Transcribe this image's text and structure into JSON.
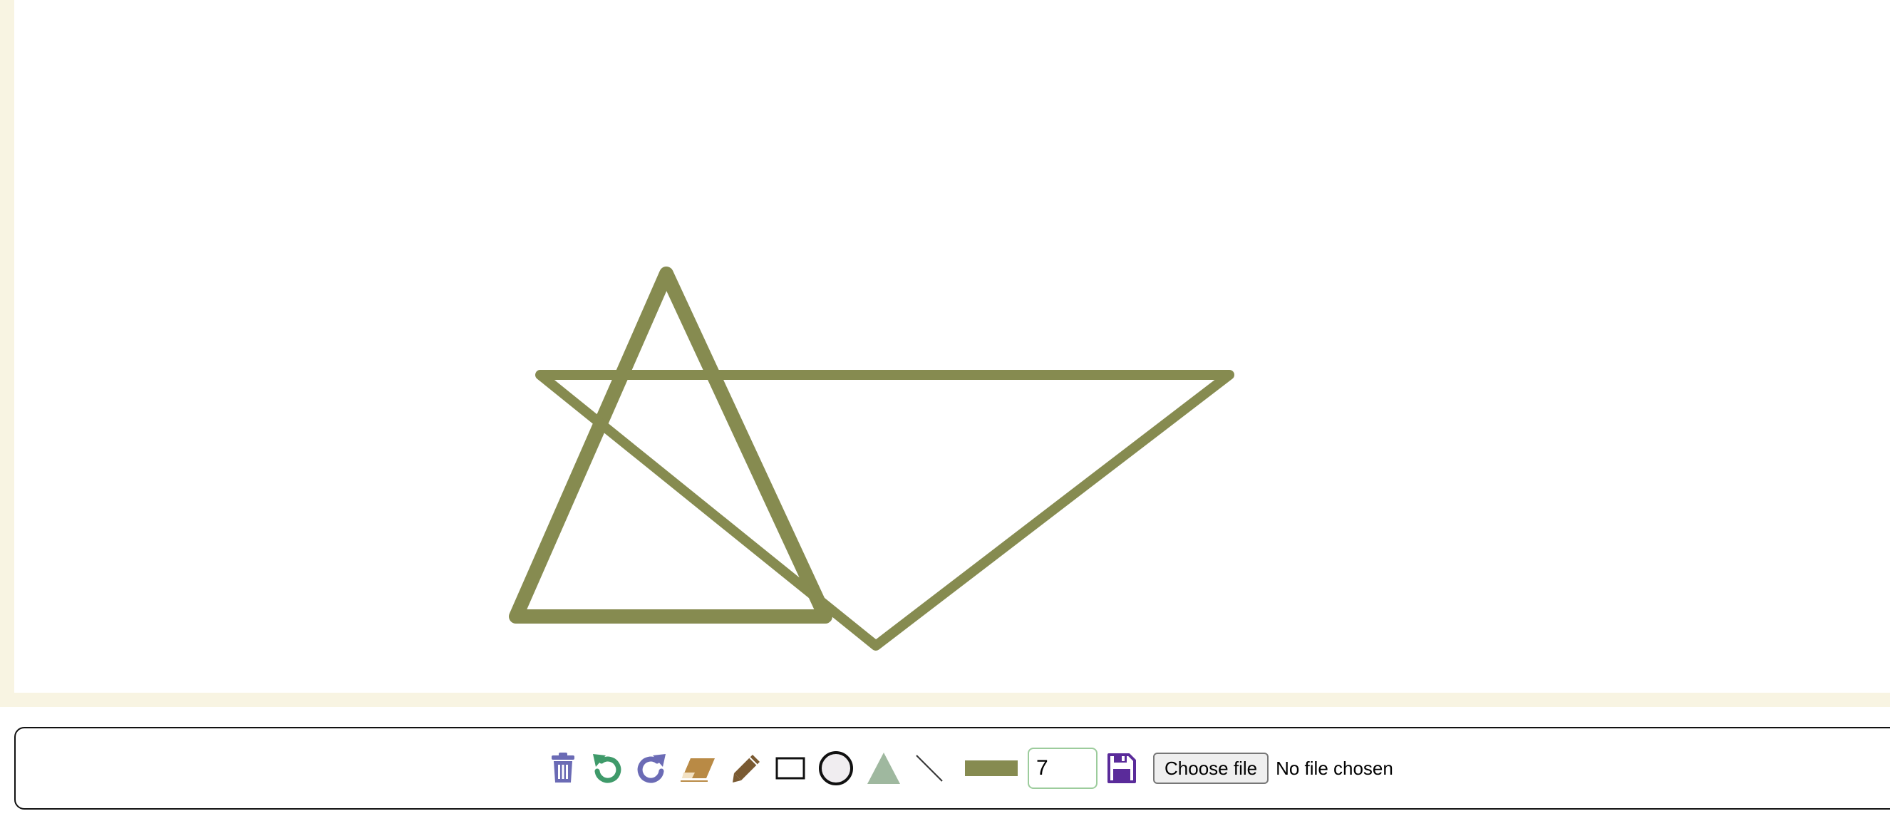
{
  "colors": {
    "stroke": "#868b50",
    "page_border": "#f8f4e2",
    "trash": "#6b6bb5",
    "undo": "#3f9a6a",
    "redo": "#6b6bb5",
    "eraser": "#b98a45",
    "pencil": "#7a5a32",
    "triangle_fill": "#9fb89f",
    "save": "#5a2b9a"
  },
  "canvas": {
    "shapes": [
      {
        "type": "triangle",
        "name": "triangle-outline-1"
      },
      {
        "type": "triangle",
        "name": "triangle-outline-2"
      }
    ]
  },
  "toolbar": {
    "tools": [
      {
        "name": "trash-icon",
        "label": "clear"
      },
      {
        "name": "undo-icon",
        "label": "undo"
      },
      {
        "name": "redo-icon",
        "label": "redo"
      },
      {
        "name": "eraser-icon",
        "label": "eraser"
      },
      {
        "name": "pencil-icon",
        "label": "pencil"
      },
      {
        "name": "rectangle-icon",
        "label": "rectangle"
      },
      {
        "name": "circle-icon",
        "label": "circle"
      },
      {
        "name": "triangle-icon",
        "label": "triangle"
      },
      {
        "name": "line-icon",
        "label": "line"
      }
    ],
    "color_swatch": "#868b50",
    "line_width": "7",
    "save_icon": "floppy-disk-icon",
    "file_button_label": "Choose file",
    "file_status": "No file chosen"
  }
}
